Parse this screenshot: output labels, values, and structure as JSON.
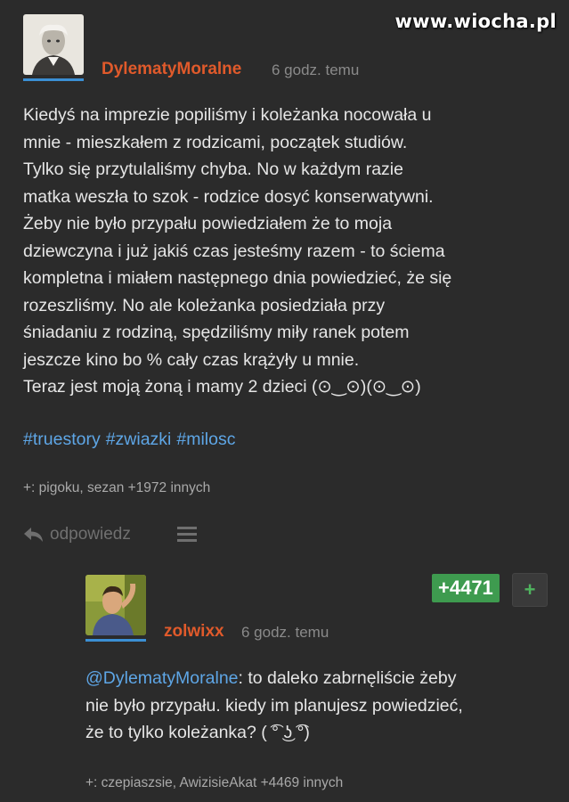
{
  "watermark": "www.wiocha.pl",
  "post": {
    "author": "DylematyMoralne",
    "time": "6 godz. temu",
    "body": "Kiedyś na imprezie popiliśmy i koleżanka nocowała u\nmnie - mieszkałem z rodzicami, początek studiów.\nTylko się przytulaliśmy chyba. No w każdym razie\nmatka weszła to szok - rodzice dosyć konserwatywni.\nŻeby nie było przypału powiedziałem że to moja\ndziewczyna i już jakiś czas jesteśmy razem - to ściema\nkompletna i miałem następnego dnia powiedzieć, że się\nrozeszliśmy. No ale koleżanka posiedziała przy\nśniadaniu z rodziną, spędziliśmy miły ranek potem\njeszcze kino bo % cały czas krążyły u mnie.\nTeraz jest moją żoną i mamy 2 dzieci (⊙‿⊙)(⊙‿⊙)",
    "tags": [
      "#truestory",
      "#zwiazki",
      "#milosc"
    ],
    "voters": "+: pigoku, sezan +1972 innych",
    "reply_label": "odpowiedz",
    "reply_icon": "reply-arrow-icon",
    "menu_icon": "hamburger-menu-icon"
  },
  "comment": {
    "author": "zolwixx",
    "time": "6 godz. temu",
    "vote_count": "+4471",
    "plus_label": "+",
    "mention": "@DylematyMoralne",
    "body_after_mention": ": to daleko zabrnęliście żeby",
    "body_rest": "nie było przypału. kiedy im planujesz powiedzieć,\nże to tylko koleżanka? ( ͡° ͜ʖ ͡°)",
    "voters": "+: czepiaszsie, AwizisieAkat +4469 innych"
  },
  "colors": {
    "background": "#2b2b2b",
    "author": "#e05a2b",
    "tag": "#5ea6e6",
    "vote_green": "#3e9b4f",
    "avatar_underline": "#3b8fd4"
  }
}
